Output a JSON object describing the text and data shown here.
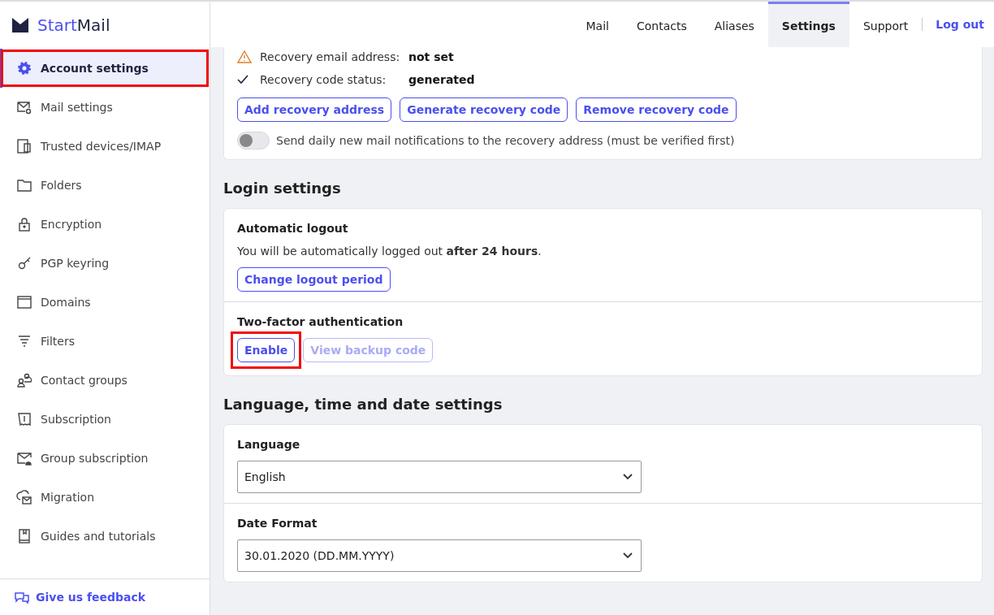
{
  "brand": {
    "part_1": "Start",
    "part_2": "Mail"
  },
  "sidebar": {
    "items": [
      {
        "label": "Account settings",
        "kind": "gear",
        "selected": true,
        "highlighted": true
      },
      {
        "label": "Mail settings",
        "kind": "mail-gear",
        "selected": false,
        "highlighted": false
      },
      {
        "label": "Trusted devices/IMAP",
        "kind": "devices",
        "selected": false,
        "highlighted": false
      },
      {
        "label": "Folders",
        "kind": "folder",
        "selected": false,
        "highlighted": false
      },
      {
        "label": "Encryption",
        "kind": "lock",
        "selected": false,
        "highlighted": false
      },
      {
        "label": "PGP keyring",
        "kind": "key",
        "selected": false,
        "highlighted": false
      },
      {
        "label": "Domains",
        "kind": "browser",
        "selected": false,
        "highlighted": false
      },
      {
        "label": "Filters",
        "kind": "filter",
        "selected": false,
        "highlighted": false
      },
      {
        "label": "Contact groups",
        "kind": "people",
        "selected": false,
        "highlighted": false
      },
      {
        "label": "Subscription",
        "kind": "receipt",
        "selected": false,
        "highlighted": false
      },
      {
        "label": "Group subscription",
        "kind": "mail-person",
        "selected": false,
        "highlighted": false
      },
      {
        "label": "Migration",
        "kind": "cloud-mail",
        "selected": false,
        "highlighted": false
      },
      {
        "label": "Guides and tutorials",
        "kind": "book",
        "selected": false,
        "highlighted": false
      }
    ],
    "feedback": "Give us feedback"
  },
  "nav": {
    "tabs": [
      {
        "label": "Mail",
        "selected": false
      },
      {
        "label": "Contacts",
        "selected": false
      },
      {
        "label": "Aliases",
        "selected": false
      },
      {
        "label": "Settings",
        "selected": true
      },
      {
        "label": "Support",
        "selected": false
      }
    ],
    "logout": "Log out"
  },
  "recovery": {
    "rows": [
      {
        "kind": "warning",
        "label": "Recovery email address:",
        "value": "not set"
      },
      {
        "kind": "check",
        "label": "Recovery code status:",
        "value": "generated"
      }
    ],
    "buttons": [
      "Add recovery address",
      "Generate recovery code",
      "Remove recovery code"
    ],
    "notifications": {
      "label": "Send daily new mail notifications to the recovery address (must be verified first)",
      "on": false
    }
  },
  "login": {
    "heading": "Login settings",
    "auto_logout": {
      "title": "Automatic logout",
      "text": "You will be automatically logged out **after 24 hours**.",
      "button": "Change logout period"
    },
    "two_factor": {
      "title": "Two-factor authentication",
      "buttons": [
        {
          "label": "Enable",
          "disabled": false,
          "highlighted": true
        },
        {
          "label": "View backup code",
          "disabled": true,
          "highlighted": false
        }
      ]
    }
  },
  "locale": {
    "heading": "Language, time and date settings",
    "fields": [
      {
        "label": "Language",
        "value": "English"
      },
      {
        "label": "Date Format",
        "value": "30.01.2020 (DD.MM.YYYY)"
      }
    ]
  }
}
